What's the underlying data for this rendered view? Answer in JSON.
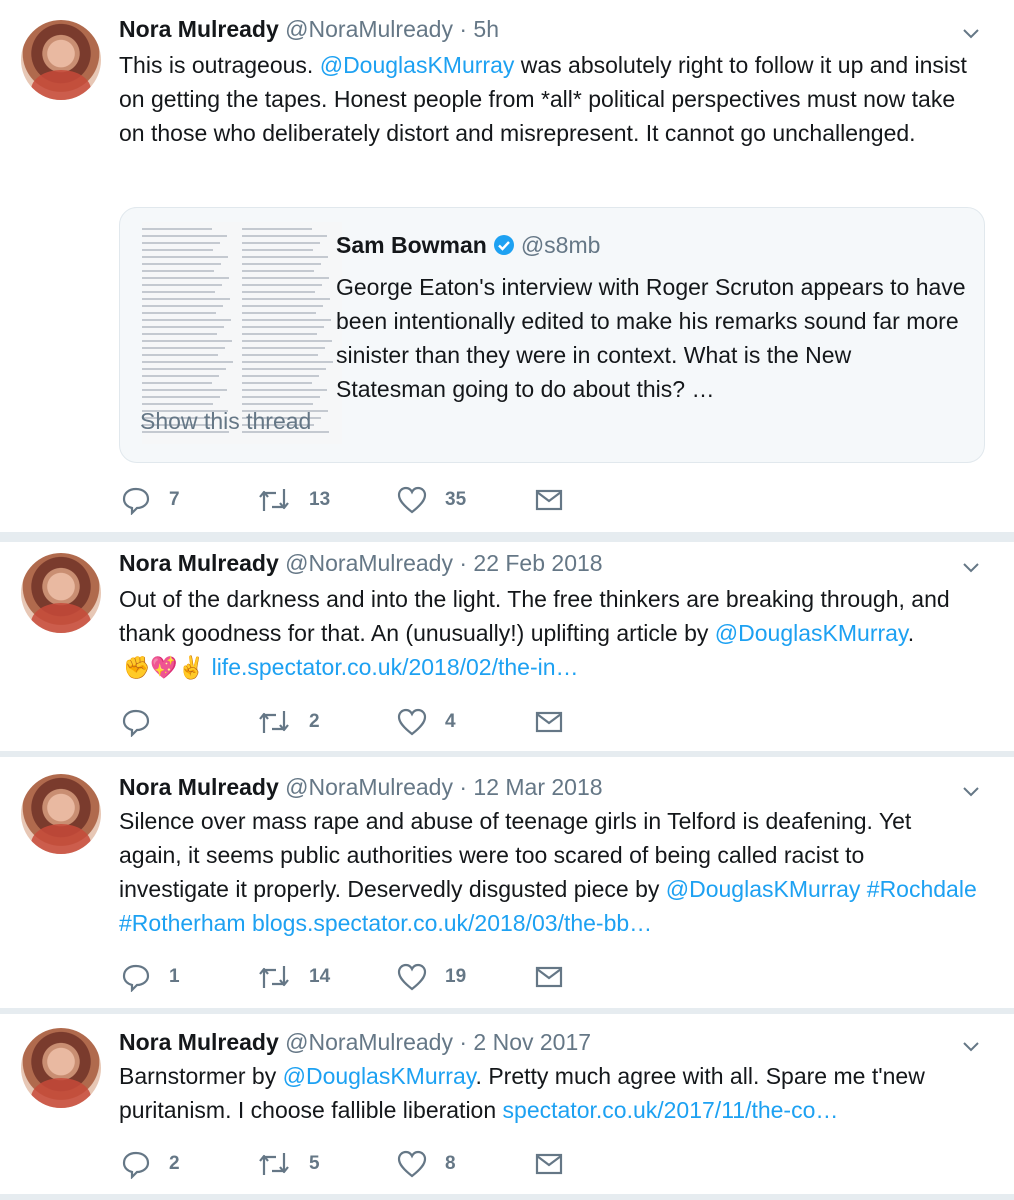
{
  "tweets": [
    {
      "name": "Nora Mulready",
      "handle": "@NoraMulready",
      "sep": "·",
      "time": "5h",
      "text": [
        {
          "t": "plain",
          "v": "This is outrageous. "
        },
        {
          "t": "mention",
          "v": "@DouglasKMurray"
        },
        {
          "t": "plain",
          "v": " was absolutely right to follow it up and insist on getting the tapes. Honest people from *all* political perspectives must now take on those who deliberately distort and misrepresent. It cannot go unchallenged."
        }
      ],
      "quote": {
        "name": "Sam Bowman",
        "handle": "@s8mb",
        "text": "George Eaton's interview with Roger Scruton appears to have been intentionally edited to make his remarks sound far more sinister than they were in context. What is the New Statesman going to do about this? …",
        "show_thread": "Show this thread",
        "verified_color": "#1da1f2"
      },
      "replies": "7",
      "retweets": "13",
      "likes": "35"
    },
    {
      "name": "Nora Mulready",
      "handle": "@NoraMulready",
      "sep": "·",
      "time": "22 Feb 2018",
      "text": [
        {
          "t": "plain",
          "v": "Out of the darkness and into the light. The free thinkers are breaking through, and thank goodness for that. An (unusually!) uplifting article by "
        },
        {
          "t": "mention",
          "v": "@DouglasKMurray"
        },
        {
          "t": "plain",
          "v": ". "
        },
        {
          "t": "emoji",
          "v": "✊💖✌️"
        },
        {
          "t": "plain",
          "v": " "
        },
        {
          "t": "link",
          "v": "life.spectator.co.uk/2018/02/the-in…"
        }
      ],
      "replies": "",
      "retweets": "2",
      "likes": "4"
    },
    {
      "name": "Nora Mulready",
      "handle": "@NoraMulready",
      "sep": "·",
      "time": "12 Mar 2018",
      "text": [
        {
          "t": "plain",
          "v": "Silence over mass rape and abuse of teenage girls in Telford is deafening. Yet again, it seems public authorities were too scared of being called racist to investigate it properly. Deservedly disgusted piece by "
        },
        {
          "t": "mention",
          "v": "@DouglasKMurray"
        },
        {
          "t": "plain",
          "v": " "
        },
        {
          "t": "hashtag",
          "v": "#Rochdale"
        },
        {
          "t": "plain",
          "v": " "
        },
        {
          "t": "hashtag",
          "v": "#Rotherham"
        },
        {
          "t": "plain",
          "v": " "
        },
        {
          "t": "link",
          "v": "blogs.spectator.co.uk/2018/03/the-bb…"
        }
      ],
      "replies": "1",
      "retweets": "14",
      "likes": "19"
    },
    {
      "name": "Nora Mulready",
      "handle": "@NoraMulready",
      "sep": "·",
      "time": "2 Nov 2017",
      "text": [
        {
          "t": "plain",
          "v": "Barnstormer by "
        },
        {
          "t": "mention",
          "v": "@DouglasKMurray"
        },
        {
          "t": "plain",
          "v": ". Pretty much agree with all. Spare me t'new puritanism. I choose fallible  liberation "
        },
        {
          "t": "link",
          "v": "spectator.co.uk/2017/11/the-co…"
        }
      ],
      "replies": "2",
      "retweets": "5",
      "likes": "8"
    }
  ],
  "icons": {
    "reply": "reply-icon",
    "retweet": "retweet-icon",
    "like": "heart-icon",
    "dm": "envelope-icon",
    "caret": "chevron-down-icon",
    "verified": "verified-badge-icon"
  },
  "colors": {
    "link": "#1da1f2",
    "muted": "#657786",
    "divider": "#e6ecf0"
  }
}
